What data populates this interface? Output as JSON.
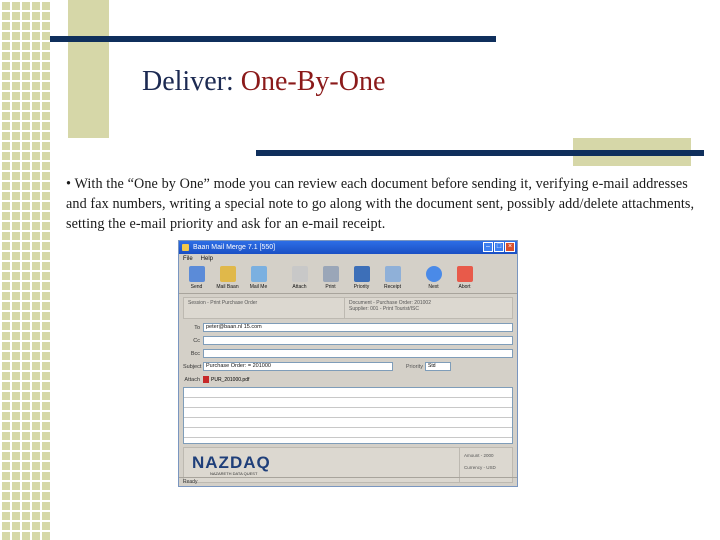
{
  "slide": {
    "title_prefix": "Deliver: ",
    "title_accent": "One-By-One",
    "bullet": "• With the “One by One” mode you can review each document before sending it, verifying e-mail addresses and fax numbers, writing a special note to go along with the document sent, possibly add/delete attachments, setting the e-mail priority and ask for an e-mail receipt."
  },
  "colors": {
    "navy": "#0f2f5c",
    "olive": "#d6d7a8",
    "title_accent": "#8b1a1a"
  },
  "screenshot": {
    "window_title": "Baan Mail Merge 7.1 [550]",
    "menu": [
      "File",
      "Help"
    ],
    "toolbar": [
      {
        "label": "Send",
        "icon": "send-icon"
      },
      {
        "label": "Mail Baan",
        "icon": "mail-baan-icon"
      },
      {
        "label": "Mail Me",
        "icon": "mail-me-icon"
      },
      {
        "label": "Attach",
        "icon": "attach-icon"
      },
      {
        "label": "Print",
        "icon": "print-icon"
      },
      {
        "label": "Priority",
        "icon": "priority-icon"
      },
      {
        "label": "Receipt",
        "icon": "receipt-icon"
      },
      {
        "label": "Next",
        "icon": "next-icon"
      },
      {
        "label": "Abort",
        "icon": "abort-icon"
      }
    ],
    "info_left": "Session - Print Purchase Order",
    "info_right_1": "Document - Purchase Order: 201002",
    "info_right_2": "Supplier: 001 - Print Tourist/ISC",
    "fields": {
      "to_label": "To",
      "to_value": "peter@baan.nl 15.com",
      "cc_label": "Cc",
      "bcc_label": "Bcc",
      "subject_label": "Subject",
      "subject_value": "Purchase Order: = 201000",
      "priority_label": "Priority",
      "priority_value": "Std",
      "attach_label": "Attach",
      "attach_file": "PUR_201000.pdf"
    },
    "logo": "NAZDAQ",
    "logo_sub": "NAZARETH DATA QUEST",
    "footer_info_1": "Amount - 2000",
    "footer_info_2": "Currency - USD",
    "status": "Ready"
  }
}
